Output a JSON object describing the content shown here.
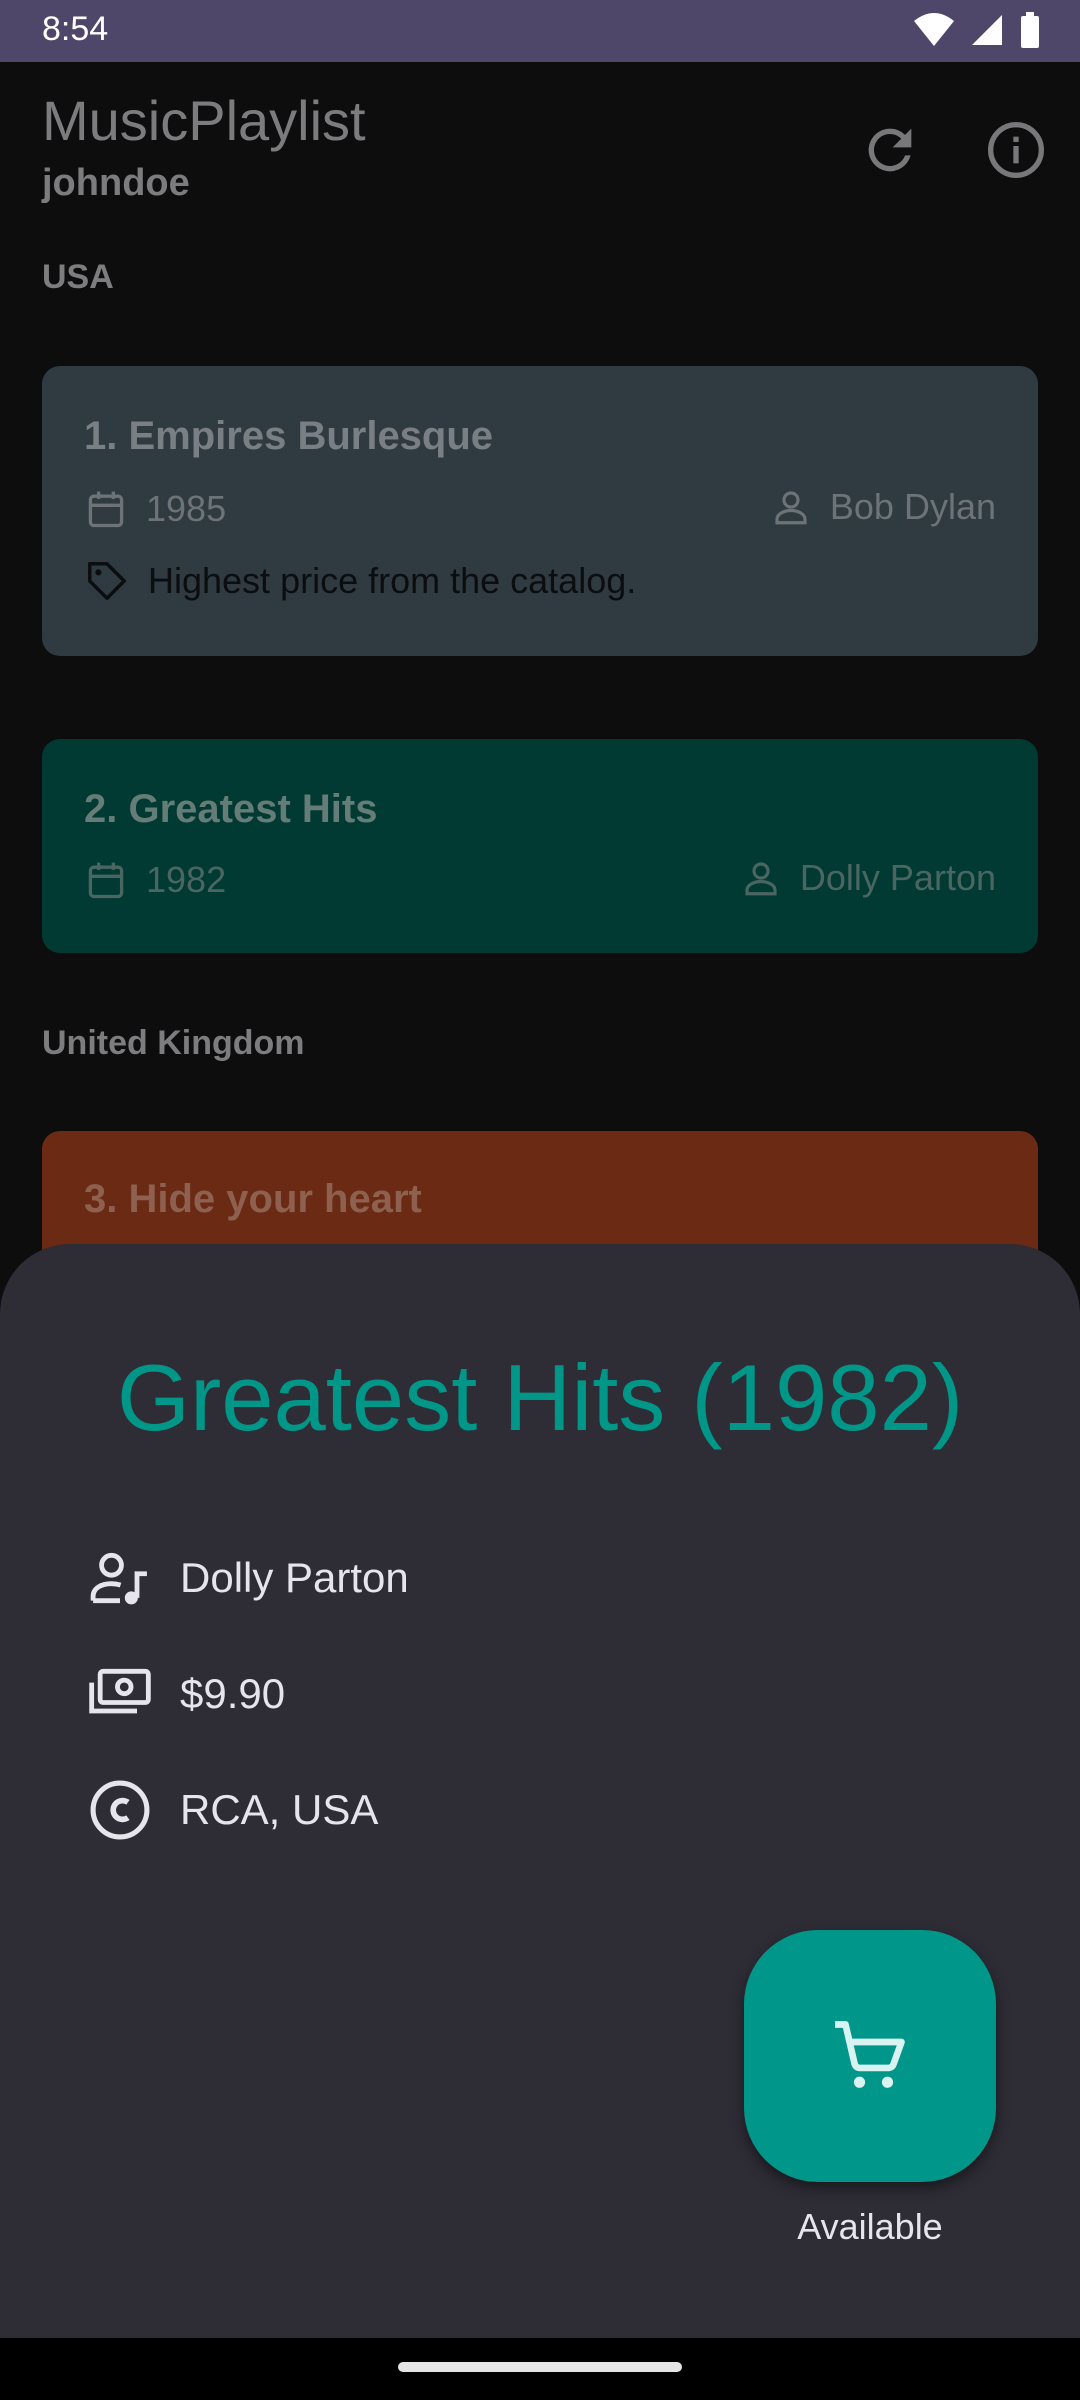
{
  "status_bar": {
    "time": "8:54",
    "icons": [
      "wifi-icon",
      "signal-icon",
      "battery-icon"
    ]
  },
  "app_bar": {
    "title": "MusicPlaylist",
    "subtitle": "johndoe",
    "actions": [
      "refresh-icon",
      "info-icon"
    ]
  },
  "sections": [
    {
      "header": "USA"
    },
    {
      "header": "United Kingdom"
    }
  ],
  "cards": [
    {
      "title": "1. Empires Burlesque",
      "year": "1985",
      "artist": "Bob Dylan",
      "note": "Highest price from the catalog.",
      "color": "#2f3b41"
    },
    {
      "title": "2. Greatest Hits",
      "year": "1982",
      "artist": "Dolly Parton",
      "color": "#003a33"
    },
    {
      "title": "3. Hide your heart",
      "color": "#6b2a13"
    }
  ],
  "sheet": {
    "title": "Greatest Hits (1982)",
    "artist": "Dolly Parton",
    "price": "$9.90",
    "label": "RCA, USA",
    "fab_label": "Available",
    "accent": "#009688"
  },
  "colors": {
    "background": "#0d0d0e",
    "status_bar": "#4f4769",
    "sheet": "#2e2c35",
    "fab": "#00968a"
  }
}
